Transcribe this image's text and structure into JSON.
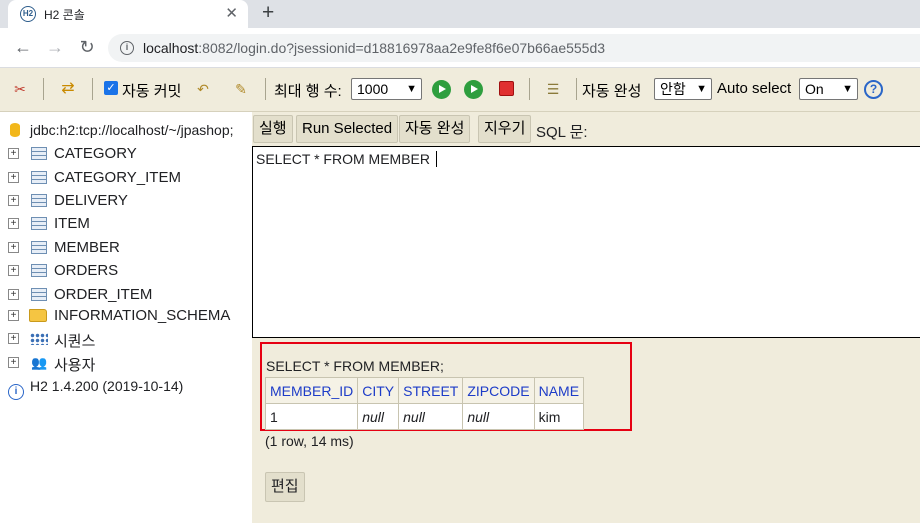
{
  "browser": {
    "tab_favicon": "H2",
    "tab_title": "H2 콘솔",
    "close_glyph": "✕",
    "new_tab_glyph": "+",
    "url_host": "localhost",
    "url_rest": ":8082/login.do?jsessionid=d18816978aa2e9fe8f6e07b66ae555d3"
  },
  "h2_toolbar": {
    "autocommit_label": "자동 커밋",
    "autocommit_checked": true,
    "max_rows_label": "최대 행 수:",
    "max_rows_value": "1000",
    "autocomplete_label": "자동 완성",
    "autocomplete_value": "안함",
    "autoselect_label": "Auto select",
    "autoselect_value": "On"
  },
  "tree": {
    "connection": "jdbc:h2:tcp://localhost/~/jpashop;",
    "tables": [
      "CATEGORY",
      "CATEGORY_ITEM",
      "DELIVERY",
      "ITEM",
      "MEMBER",
      "ORDERS",
      "ORDER_ITEM"
    ],
    "schema": "INFORMATION_SCHEMA",
    "sequences": "시퀀스",
    "users": "사용자",
    "version": "H2 1.4.200 (2019-10-14)"
  },
  "commands": {
    "run": "실행",
    "run_selected": "Run Selected",
    "autocomplete": "자동 완성",
    "clear": "지우기",
    "sql_label": "SQL 문:"
  },
  "editor": {
    "sql": "SELECT * FROM MEMBER"
  },
  "result": {
    "sql": "SELECT * FROM MEMBER;",
    "columns": [
      "MEMBER_ID",
      "CITY",
      "STREET",
      "ZIPCODE",
      "NAME"
    ],
    "rows": [
      [
        "1",
        "null",
        "null",
        "null",
        "kim"
      ]
    ],
    "summary": "(1 row, 14 ms)",
    "edit_button": "편집"
  },
  "colors": {
    "panel_bg": "#f0ecdc",
    "highlight_border": "#e60012",
    "header_text": "#1d3cc8"
  }
}
